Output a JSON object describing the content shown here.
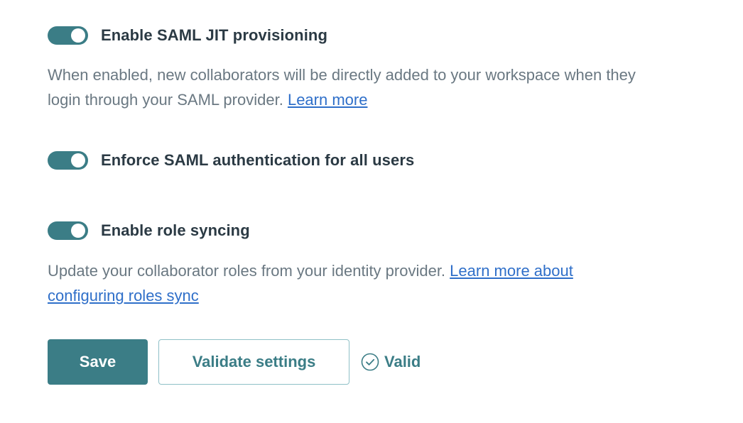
{
  "settings": {
    "jit": {
      "label": "Enable SAML JIT provisioning",
      "enabled": true,
      "description": "When enabled, new collaborators will be directly added to your workspace when they login through your SAML provider.",
      "link": "Learn more"
    },
    "enforce": {
      "label": "Enforce SAML authentication for all users",
      "enabled": true
    },
    "role_sync": {
      "label": "Enable role syncing",
      "enabled": true,
      "description": "Update your collaborator roles from your identity provider.",
      "link": "Learn more about configuring roles sync"
    }
  },
  "actions": {
    "save_label": "Save",
    "validate_label": "Validate settings",
    "status_label": "Valid"
  },
  "colors": {
    "accent": "#3b7d86",
    "link": "#2f6fc9",
    "heading": "#2b3a44",
    "muted": "#6a7882"
  },
  "icons": {
    "status": "check-circle-icon"
  }
}
